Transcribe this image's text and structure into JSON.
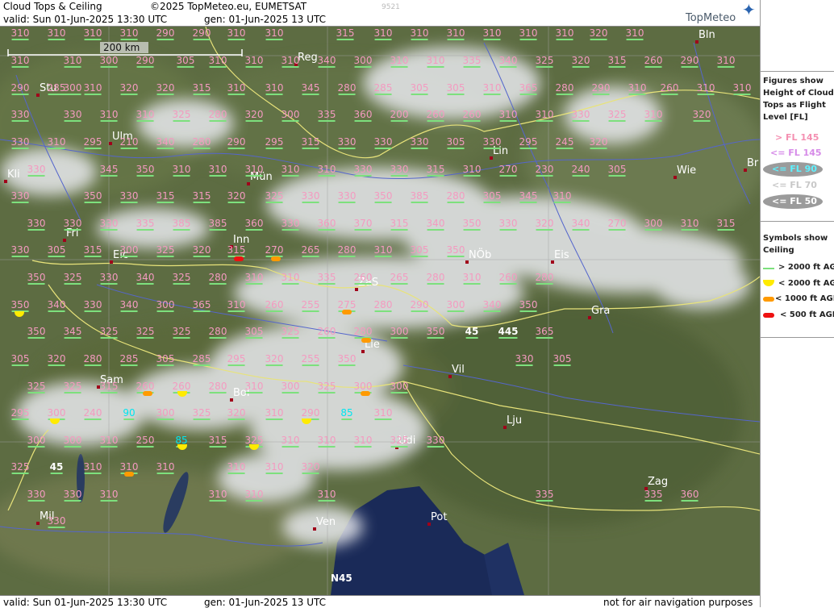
{
  "header": {
    "title": "Cloud Tops & Ceiling",
    "copyright": "©2025 TopMeteo.eu, EUMETSAT",
    "code": "9521",
    "valid": "valid:  Sun  01-Jun-2025  13:30 UTC",
    "gen": "gen: 01-Jun-2025 13 UTC",
    "brand": "TopMeteo"
  },
  "footer": {
    "valid": "valid:  Sun  01-Jun-2025  13:30 UTC",
    "gen": "gen: 01-Jun-2025 13 UTC",
    "disclaimer": "not for air navigation purposes"
  },
  "scale_label": "200 km",
  "lat_label": "N45",
  "legend": {
    "title_lines": [
      "Figures show",
      "Height of Cloud",
      "Tops as Flight",
      "Level  [FL]"
    ],
    "items": [
      {
        "text": "> FL 145",
        "color": "#f48fb1"
      },
      {
        "text": "<= FL 145",
        "color": "#d68be8"
      },
      {
        "text": "<= FL 90",
        "color": "#5ef2ff"
      },
      {
        "text": "<= FL 70",
        "color": "#c8c8c8"
      },
      {
        "text": "<= FL 50",
        "color": "#ffffff"
      }
    ]
  },
  "symbols": {
    "title_lines": [
      "Symbols show",
      "Ceiling"
    ],
    "items": [
      {
        "text": "> 2000 ft AGL",
        "color": "#7de07d",
        "shape": "line"
      },
      {
        "text": "< 2000 ft AGL",
        "color": "#ffeb00",
        "shape": "half"
      },
      {
        "text": "< 1000 ft AGL",
        "color": "#ff9a00",
        "shape": "pill"
      },
      {
        "text": "< 500 ft AGL",
        "color": "#ee1111",
        "shape": "pill"
      }
    ]
  },
  "cities": [
    "Bln",
    "Stu",
    "Reg",
    "Ulm",
    "Lin",
    "Wie",
    "Kli",
    "Mün",
    "Br",
    "Fri",
    "Eic",
    "NÖb",
    "Eis",
    "ZaS",
    "Inn",
    "Gra",
    "Lie",
    "Vil",
    "Sam",
    "Bol",
    "Lju",
    "Udi",
    "Zag",
    "Mil",
    "Pot",
    "Ven"
  ],
  "labels": [
    "310",
    "310",
    "310",
    "310",
    "290",
    "290",
    "310",
    "310",
    "315",
    "310",
    "310",
    "310",
    "310",
    "310",
    "310",
    "320",
    "310",
    "310",
    "310",
    "300",
    "290",
    "305",
    "310",
    "310",
    "310",
    "340",
    "300",
    "310",
    "310",
    "335",
    "340",
    "325",
    "320",
    "315",
    "260",
    "290",
    "310",
    "290",
    "285",
    "300",
    "310",
    "320",
    "320",
    "315",
    "310",
    "310",
    "345",
    "280",
    "285",
    "305",
    "305",
    "310",
    "365",
    "280",
    "290",
    "310",
    "260",
    "310",
    "310",
    "330",
    "330",
    "310",
    "310",
    "325",
    "280",
    "320",
    "300",
    "335",
    "360",
    "200",
    "260",
    "260",
    "310",
    "310",
    "330",
    "325",
    "310",
    "320",
    "330",
    "310",
    "295",
    "210",
    "340",
    "280",
    "290",
    "295",
    "315",
    "330",
    "330",
    "330",
    "305",
    "330",
    "295",
    "245",
    "320",
    "330",
    "345",
    "350",
    "310",
    "310",
    "310",
    "310",
    "310",
    "330",
    "330",
    "315",
    "310",
    "270",
    "230",
    "240",
    "305",
    "330",
    "350",
    "330",
    "315",
    "315",
    "320",
    "325",
    "330",
    "330",
    "350",
    "385",
    "280",
    "305",
    "345",
    "310",
    "330",
    "330",
    "330",
    "335",
    "385",
    "385",
    "360",
    "330",
    "360",
    "370",
    "315",
    "340",
    "350",
    "330",
    "320",
    "340",
    "270",
    "300",
    "310",
    "315",
    "330",
    "305",
    "315",
    "300",
    "325",
    "320",
    "315",
    "270",
    "265",
    "280",
    "310",
    "305",
    "350",
    "350",
    "325",
    "330",
    "340",
    "325",
    "280",
    "310",
    "310",
    "335",
    "260",
    "265",
    "280",
    "310",
    "260",
    "280",
    "350",
    "340",
    "330",
    "340",
    "300",
    "365",
    "310",
    "260",
    "255",
    "275",
    "280",
    "290",
    "300",
    "340",
    "350",
    "350",
    "345",
    "325",
    "325",
    "325",
    "280",
    "305",
    "325",
    "260",
    "280",
    "300",
    "350",
    "45",
    "445",
    "365",
    "305",
    "320",
    "280",
    "285",
    "305",
    "285",
    "295",
    "320",
    "255",
    "350",
    "330",
    "305",
    "325",
    "325",
    "315",
    "260",
    "260",
    "280",
    "310",
    "300",
    "325",
    "300",
    "300",
    "295",
    "300",
    "240",
    "90",
    "300",
    "325",
    "320",
    "310",
    "290",
    "85",
    "310",
    "300",
    "300",
    "310",
    "250",
    "85",
    "315",
    "325",
    "310",
    "310",
    "310",
    "325",
    "330",
    "325",
    "45",
    "310",
    "310",
    "310",
    "310",
    "310",
    "320",
    "330",
    "330",
    "310",
    "310",
    "310",
    "310",
    "335",
    "335",
    "360",
    "330"
  ]
}
